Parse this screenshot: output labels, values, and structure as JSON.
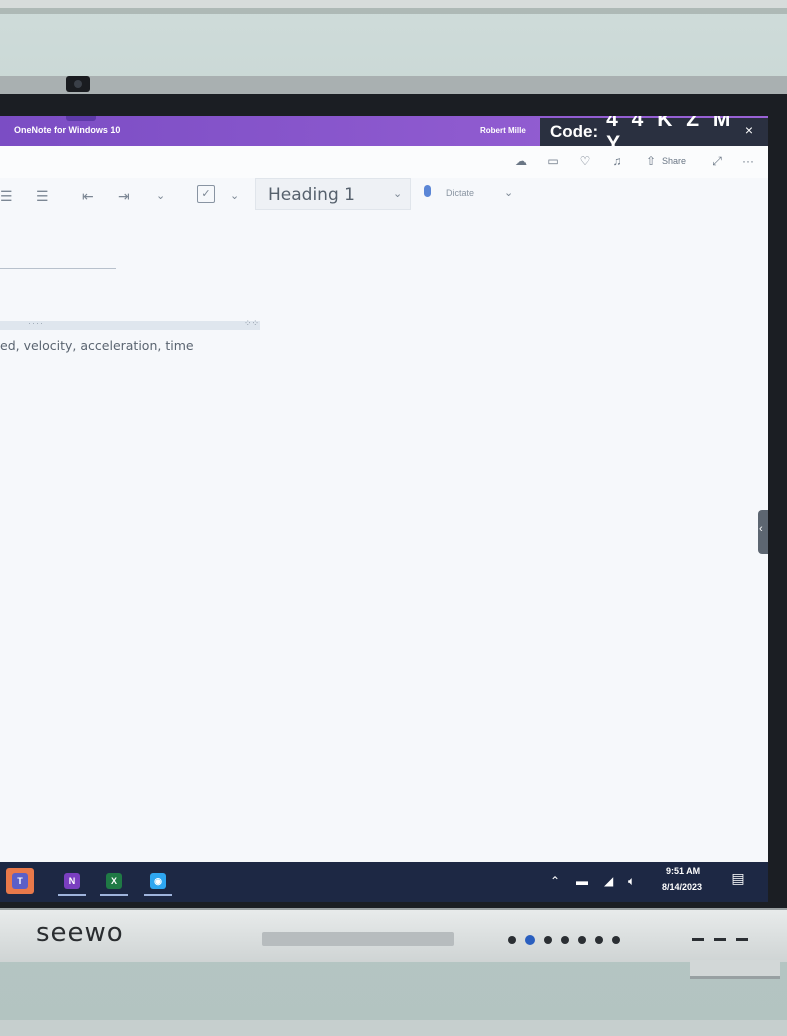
{
  "window": {
    "app_title": "OneNote for Windows 10",
    "user_name": "Robert Mille",
    "code_label": "Code:",
    "code_value": "4 4 K Z M Y",
    "close_glyph": "×"
  },
  "top_icons": {
    "share_label": "Share",
    "more_glyph": "···"
  },
  "ribbon": {
    "style_value": "Heading 1",
    "dictate_label": "Dictate"
  },
  "page": {
    "container_dots": "····",
    "container_handle": "⁘⁘",
    "note_text": "ed, velocity, acceleration, time"
  },
  "taskbar": {
    "apps": [
      {
        "name": "teams",
        "glyph": "T",
        "color": "#5b5fc7",
        "accent": "#e9794a"
      },
      {
        "name": "onenote",
        "glyph": "N",
        "color": "#7a3fc0"
      },
      {
        "name": "excel",
        "glyph": "X",
        "color": "#1f7a45"
      },
      {
        "name": "seewo",
        "glyph": "◉",
        "color": "#2ea6f0"
      }
    ],
    "time": "9:51 AM",
    "date": "8/14/2023"
  },
  "device": {
    "brand": "seewo"
  },
  "colors": {
    "titlebar_accent": "#8a55cf",
    "taskbar_bg": "#1d2844"
  }
}
